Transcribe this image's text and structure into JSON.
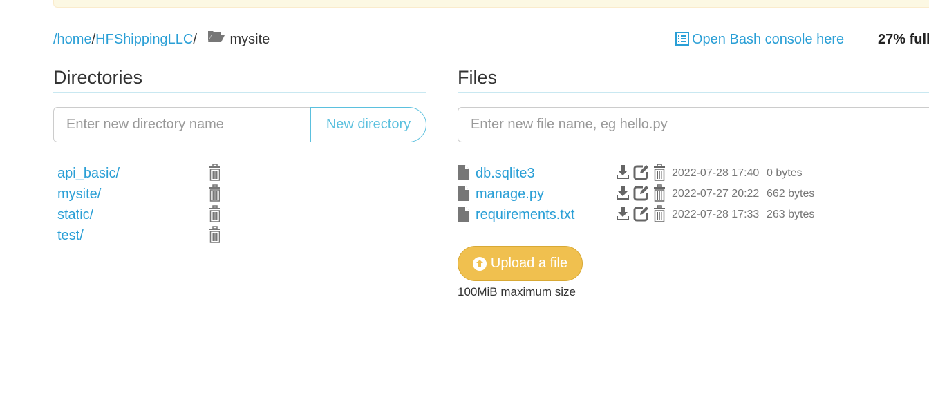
{
  "breadcrumb": {
    "segments": [
      {
        "label": "/home"
      },
      {
        "label": "HFShippingLLC"
      }
    ],
    "separator": "/",
    "current": "mysite",
    "folder_icon": "folder-open-icon"
  },
  "header": {
    "bash_link": "Open Bash console here",
    "bash_icon": "list-alt-icon",
    "quota": "27% full"
  },
  "directories": {
    "title": "Directories",
    "input_placeholder": "Enter new directory name",
    "input_value": "",
    "new_button": "New directory",
    "items": [
      {
        "name": "api_basic/"
      },
      {
        "name": "mysite/"
      },
      {
        "name": "static/"
      },
      {
        "name": "test/"
      }
    ]
  },
  "files": {
    "title": "Files",
    "input_placeholder": "Enter new file name, eg hello.py",
    "input_value": "",
    "items": [
      {
        "name": "db.sqlite3",
        "modified": "2022-07-28 17:40",
        "size": "0 bytes"
      },
      {
        "name": "manage.py",
        "modified": "2022-07-27 20:22",
        "size": "662 bytes"
      },
      {
        "name": "requirements.txt",
        "modified": "2022-07-28 17:33",
        "size": "263 bytes"
      }
    ],
    "upload_button": "Upload a file",
    "upload_note": "100MiB maximum size"
  },
  "colors": {
    "link": "#2a9fd6",
    "info": "#5bc0de",
    "warning": "#f0c04f",
    "icon_gray": "#666666"
  }
}
